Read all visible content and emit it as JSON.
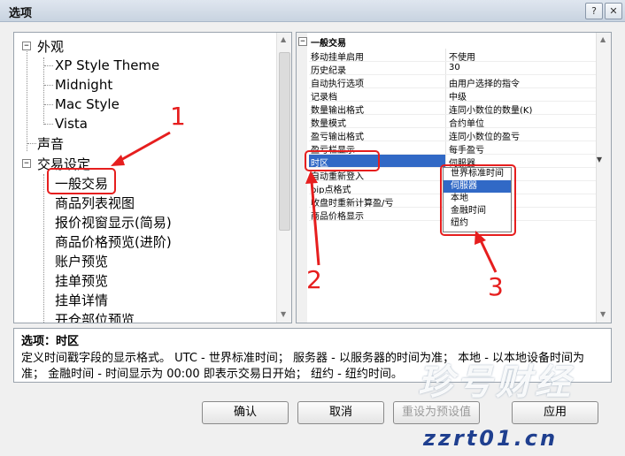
{
  "window": {
    "title": "选项",
    "help_label": "?",
    "close_label": "✕"
  },
  "tree": {
    "nodes": {
      "appearance": "外观",
      "xp": "XP Style Theme",
      "midnight": "Midnight",
      "mac": "Mac Style",
      "vista": "Vista",
      "sound": "声音",
      "trade": "交易设定",
      "general": "一般交易",
      "list": "商品列表视图",
      "quote": "报价视窗显示(简易)",
      "price": "商品价格预览(进阶)",
      "account": "账户预览",
      "order": "挂单预览",
      "order_detail": "挂单详情",
      "open_pos": "开仓部位预览"
    },
    "expand_sign": "−"
  },
  "grid": {
    "section": "一般交易",
    "rows": [
      {
        "k": "移动挂单启用",
        "v": "不使用"
      },
      {
        "k": "历史纪录",
        "v": "30"
      },
      {
        "k": "自动执行选项",
        "v": "由用户选择的指令"
      },
      {
        "k": "记录档",
        "v": "中级"
      },
      {
        "k": "数量输出格式",
        "v": "连同小数位的数量(K)"
      },
      {
        "k": "数量模式",
        "v": "合约单位"
      },
      {
        "k": "盈亏输出格式",
        "v": "连同小数位的盈亏"
      },
      {
        "k": "盈亏栏显示",
        "v": "每手盈亏"
      },
      {
        "k": "时区",
        "v": "伺服器"
      },
      {
        "k": "自动重新登入",
        "v": ""
      },
      {
        "k": "pip点格式",
        "v": ""
      },
      {
        "k": "收盘时重新计算盈/亏",
        "v": ""
      },
      {
        "k": "商品价格显示",
        "v": ""
      }
    ],
    "dropdown": [
      "世界标准时间",
      "伺服器",
      "本地",
      "金融时间",
      "纽约"
    ]
  },
  "desc": {
    "title": "选项：时区",
    "text": "定义时间戳字段的显示格式。 UTC - 世界标准时间； 服务器 - 以服务器的时间为准； 本地 - 以本地设备时间为准； 金融时间 - 时间显示为 00:00 即表示交易日开始； 纽约 - 纽约时间。"
  },
  "buttons": {
    "ok": "确认",
    "cancel": "取消",
    "reset": "重设为预设值",
    "apply": "应用"
  },
  "annotations": {
    "n1": "1",
    "n2": "2",
    "n3": "3"
  },
  "watermark": {
    "cn": "珍号财经",
    "url": "zzrt01.cn"
  },
  "colors": {
    "accent": "#3169c6",
    "annotation": "#e61e1e"
  }
}
